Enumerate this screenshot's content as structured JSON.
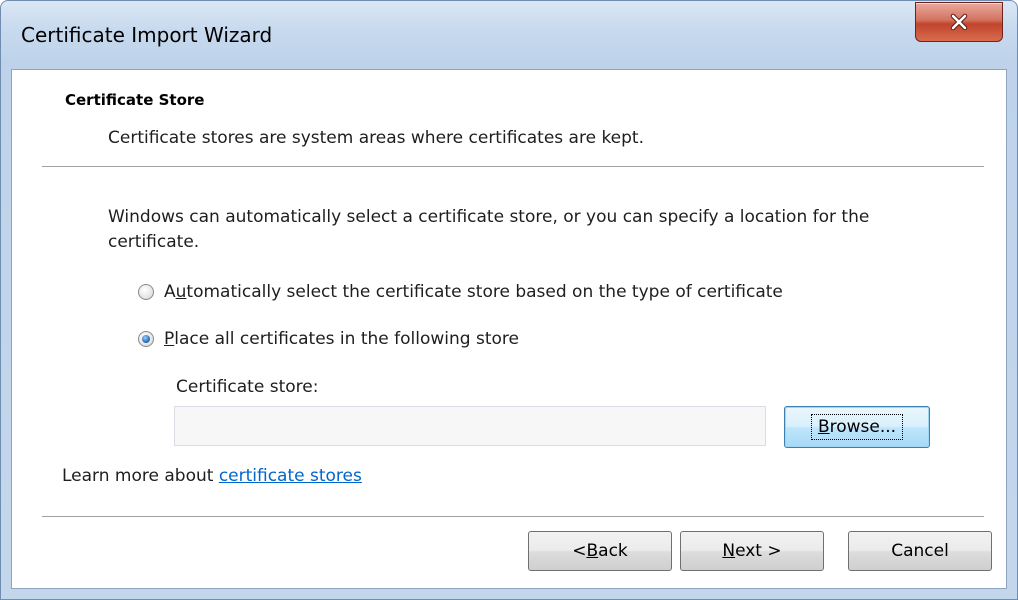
{
  "window": {
    "title": "Certificate Import Wizard"
  },
  "page": {
    "section_title": "Certificate Store",
    "section_description": "Certificate stores are system areas where certificates are kept.",
    "intro": "Windows can automatically select a certificate store, or you can specify a location for the certificate."
  },
  "options": {
    "auto_label_pre": "A",
    "auto_label_key": "u",
    "auto_label_post": "tomatically select the certificate store based on the type of certificate",
    "auto_checked": false,
    "place_label_key": "P",
    "place_label_post": "lace all certificates in the following store",
    "place_checked": true
  },
  "store": {
    "label": "Certificate store:",
    "value": "",
    "browse_key": "B",
    "browse_post": "rowse..."
  },
  "learn_more": {
    "prefix": "Learn more about ",
    "link_text": "certificate stores"
  },
  "buttons": {
    "back_pre": "< ",
    "back_key": "B",
    "back_post": "ack",
    "next_key": "N",
    "next_post": "ext >",
    "cancel": "Cancel"
  },
  "icons": {
    "close": "close-icon"
  }
}
